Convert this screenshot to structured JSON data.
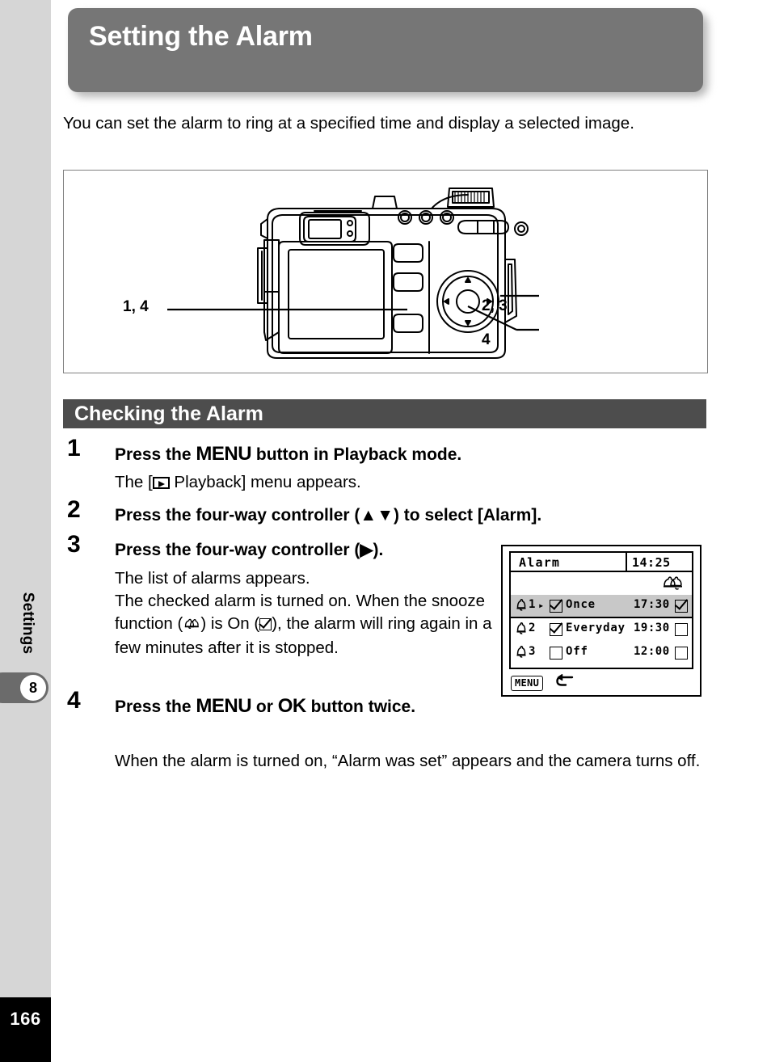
{
  "page": {
    "title": "Setting the Alarm",
    "number": "166",
    "chapter_number": "8",
    "chapter_label": "Settings"
  },
  "intro": "You can set the alarm to ring at a specified time and display a selected image.",
  "figure": {
    "name": "camera-rear-view",
    "callouts": [
      {
        "id": "callout-14",
        "label": "1, 4"
      },
      {
        "id": "callout-23",
        "label": "2, 3"
      },
      {
        "id": "callout-4",
        "label": "4"
      }
    ]
  },
  "section": {
    "header": "Checking the Alarm"
  },
  "steps": [
    {
      "number": "1",
      "head_pre": "Press the ",
      "head_button": "MENU",
      "head_post": " button in Playback mode.",
      "body_pre": "The [",
      "body_icon": "playback-icon",
      "body_post": " Playback] menu appears."
    },
    {
      "number": "2",
      "head": "Press the four-way controller (▲▼) to select [Alarm]."
    },
    {
      "number": "3",
      "head": "Press the four-way controller (▶).",
      "body_line1": "The list of alarms appears.",
      "body_line2_a": "The checked alarm is turned on. When the snooze function (",
      "body_icon_snooze": "snooze-bells-icon",
      "body_line2_b": ") is On (",
      "body_icon_check": "checked-box-icon",
      "body_line2_c": "), the alarm will ring again in a few minutes after it is stopped."
    },
    {
      "number": "4",
      "head_pre": "Press the ",
      "head_button1": "MENU",
      "head_mid": " or ",
      "head_button2": "OK",
      "head_post": " button twice.",
      "body": "When the alarm is turned on, “Alarm was set” appears and the camera turns off."
    }
  ],
  "alarm_screen": {
    "title": "Alarm",
    "clock": "14:25",
    "snooze_header_icon": "snooze-bells-icon",
    "rows": [
      {
        "index": "1",
        "selected": true,
        "marker": "▸",
        "enabled": true,
        "mode": "Once",
        "time": "17:30",
        "snooze": true
      },
      {
        "index": "2",
        "selected": false,
        "marker": "",
        "enabled": true,
        "mode": "Everyday",
        "time": "19:30",
        "snooze": false
      },
      {
        "index": "3",
        "selected": false,
        "marker": "",
        "enabled": false,
        "mode": "Off",
        "time": "12:00",
        "snooze": false
      }
    ],
    "footer": {
      "button": "MENU",
      "icon": "back-arrow-icon"
    }
  },
  "colors": {
    "title_banner": "#767676",
    "section_header": "#4d4d4d",
    "sidebar": "#d6d6d6",
    "chapter_tab": "#6b6b6b",
    "page_block": "#000000",
    "lcd_selected_row": "#c8c8c8"
  }
}
